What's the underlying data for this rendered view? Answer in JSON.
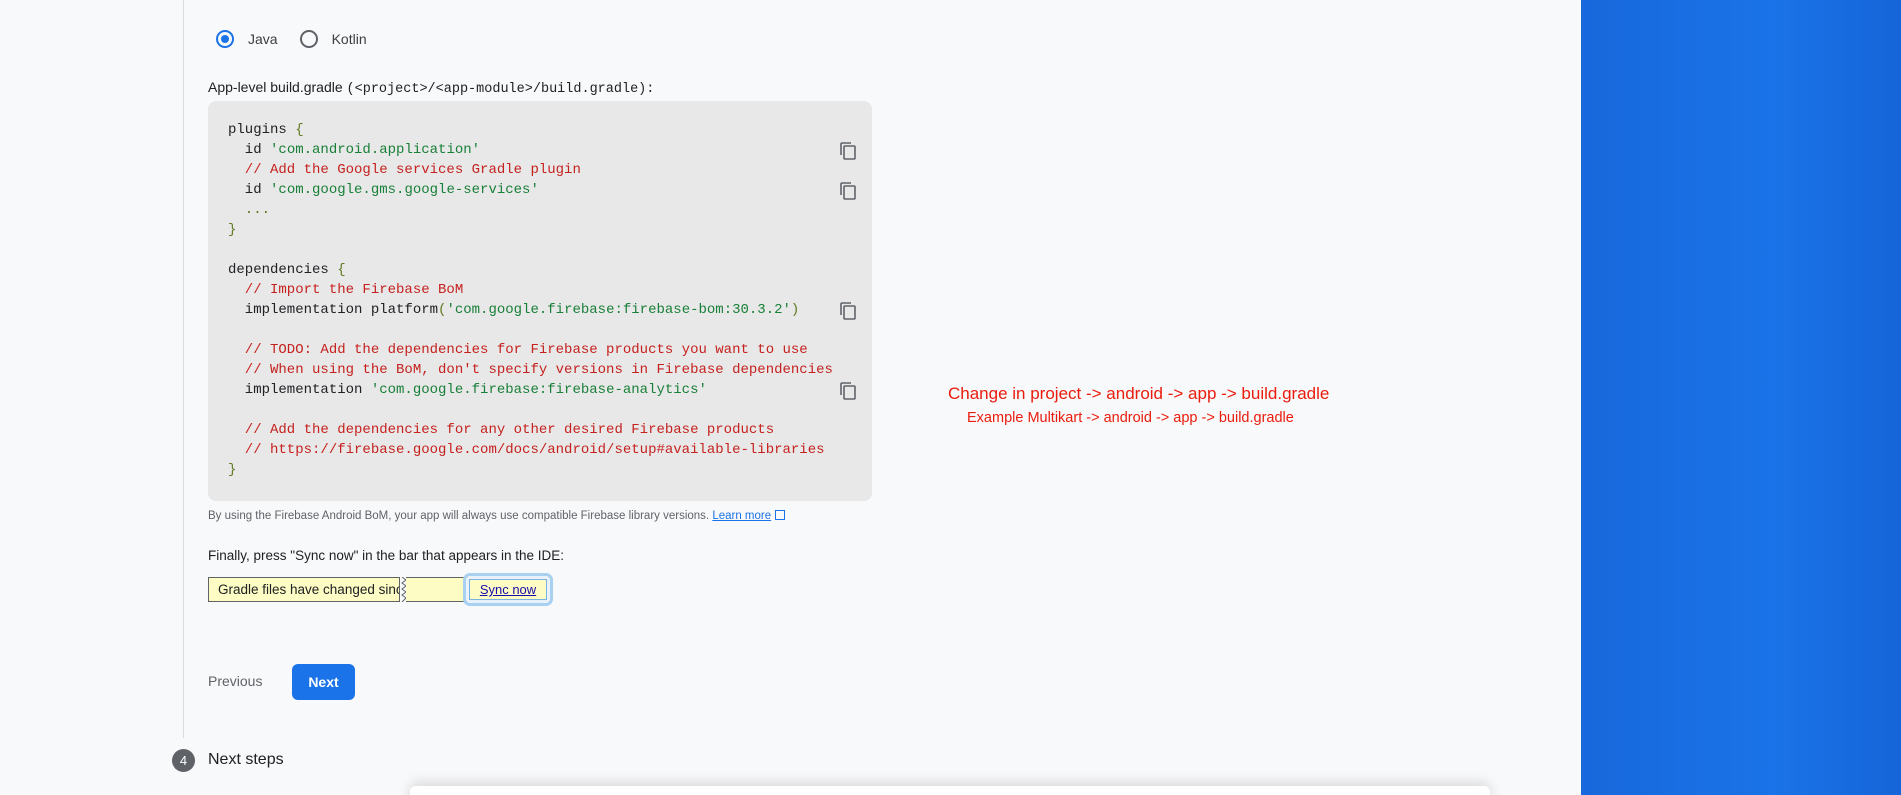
{
  "language": {
    "options": [
      {
        "label": "Java",
        "selected": true
      },
      {
        "label": "Kotlin",
        "selected": false
      }
    ]
  },
  "gradle": {
    "label_bold": "App-level build.gradle",
    "label_path": "(<project>/<app-module>/build.gradle):"
  },
  "code": {
    "lines": [
      "plugins {",
      "  id 'com.android.application'",
      "  // Add the Google services Gradle plugin",
      "  id 'com.google.gms.google-services'",
      "  ...",
      "}",
      "",
      "dependencies {",
      "  // Import the Firebase BoM",
      "  implementation platform('com.google.firebase:firebase-bom:30.3.2')",
      "",
      "  // TODO: Add the dependencies for Firebase products you want to use",
      "  // When using the BoM, don't specify versions in Firebase dependencies",
      "  implementation 'com.google.firebase:firebase-analytics'",
      "",
      "  // Add the dependencies for any other desired Firebase products",
      "  // https://firebase.google.com/docs/android/setup#available-libraries",
      "}"
    ]
  },
  "note": {
    "text": "By using the Firebase Android BoM, your app will always use compatible Firebase library versions.",
    "link": "Learn more"
  },
  "sync": {
    "instruction": "Finally, press \"Sync now\" in the bar that appears in the IDE:",
    "bar_text": "Gradle files have changed since last project sync",
    "button": "Sync now"
  },
  "nav": {
    "previous": "Previous",
    "next": "Next"
  },
  "next_step": {
    "number": "4",
    "title": "Next steps"
  },
  "annotation": {
    "line1": "Change in project -> android -> app -> build.gradle",
    "line2": "Example Multikart -> android -> app -> build.gradle"
  },
  "colors": {
    "accent": "#1a73e8",
    "annotation": "#ea1c0d",
    "code_bg": "#e8e8e8",
    "string": "#188038",
    "comment": "#c5221f"
  }
}
